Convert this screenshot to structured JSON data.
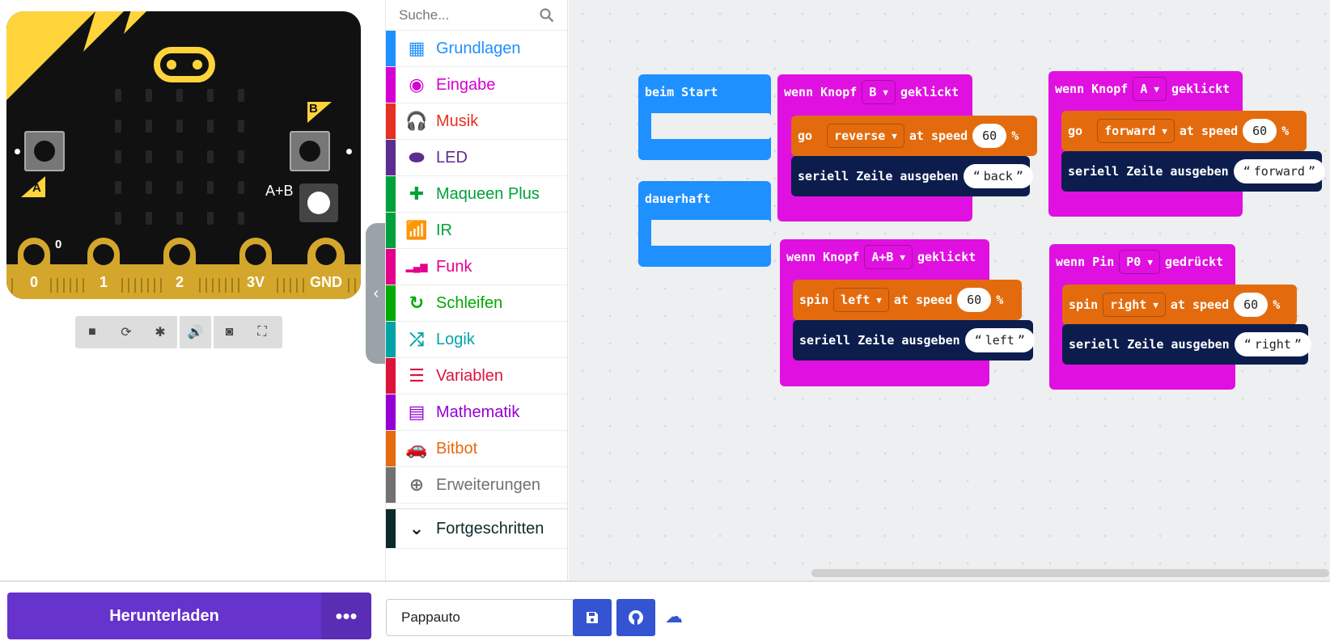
{
  "colors": {
    "accent": "#6633cc",
    "board_yellow": "#ffd43b",
    "workspace_bg": "#edeff1"
  },
  "simulator": {
    "button_a_label": "A",
    "button_b_label": "B",
    "button_ab_label": "A+B",
    "pin_zero_indicator": "0",
    "pins": [
      "0",
      "1",
      "2",
      "3V",
      "GND"
    ],
    "toolbar_icons": [
      "stop-icon",
      "restart-icon",
      "debug-icon",
      "sound-icon",
      "screenshot-icon",
      "fullscreen-icon"
    ]
  },
  "toolbox": {
    "search_placeholder": "Suche...",
    "categories": [
      {
        "label": "Grundlagen",
        "color": "#1e90ff",
        "icon": "grid-icon"
      },
      {
        "label": "Eingabe",
        "color": "#d400d4",
        "icon": "radio-icon"
      },
      {
        "label": "Musik",
        "color": "#e63022",
        "icon": "headphones-icon"
      },
      {
        "label": "LED",
        "color": "#5c2d91",
        "icon": "toggle-icon"
      },
      {
        "label": "Maqueen Plus",
        "color": "#00a13b",
        "icon": "plus-icon"
      },
      {
        "label": "IR",
        "color": "#00a13b",
        "icon": "wifi-icon"
      },
      {
        "label": "Funk",
        "color": "#e3008c",
        "icon": "signal-bars-icon"
      },
      {
        "label": "Schleifen",
        "color": "#00aa00",
        "icon": "loop-icon"
      },
      {
        "label": "Logik",
        "color": "#00a4a6",
        "icon": "shuffle-icon"
      },
      {
        "label": "Variablen",
        "color": "#dc143c",
        "icon": "list-icon"
      },
      {
        "label": "Mathematik",
        "color": "#9400d3",
        "icon": "calculator-icon"
      },
      {
        "label": "Bitbot",
        "color": "#e66a0e",
        "icon": "car-icon"
      },
      {
        "label": "Erweiterungen",
        "color": "#717171",
        "icon": "add-circle-icon"
      }
    ],
    "advanced": {
      "label": "Fortgeschritten",
      "color": "#0c2a2a",
      "icon": "chevron-down-icon"
    }
  },
  "workspace": {
    "on_start": "beim Start",
    "forever": "dauerhaft",
    "block_b": {
      "prefix": "wenn Knopf",
      "button": "B",
      "suffix": "geklickt",
      "cmd": "go",
      "direction": "reverse",
      "at_speed": "at speed",
      "speed": "60",
      "unit": "%",
      "serial": "seriell Zeile ausgeben",
      "text": "back"
    },
    "block_ab": {
      "prefix": "wenn Knopf",
      "button": "A+B",
      "suffix": "geklickt",
      "cmd": "spin",
      "direction": "left",
      "at_speed": "at speed",
      "speed": "60",
      "unit": "%",
      "serial": "seriell Zeile ausgeben",
      "text": "left"
    },
    "block_a": {
      "prefix": "wenn Knopf",
      "button": "A",
      "suffix": "geklickt",
      "cmd": "go",
      "direction": "forward",
      "at_speed": "at speed",
      "speed": "60",
      "unit": "%",
      "serial": "seriell Zeile ausgeben",
      "text": "forward"
    },
    "block_pin": {
      "prefix": "wenn Pin",
      "button": "P0",
      "suffix": "gedrückt",
      "cmd": "spin",
      "direction": "right",
      "at_speed": "at speed",
      "speed": "60",
      "unit": "%",
      "serial": "seriell Zeile ausgeben",
      "text": "right"
    }
  },
  "bottom": {
    "download_label": "Herunterladen",
    "more_label": "•••",
    "project_name": "Pappauto"
  }
}
